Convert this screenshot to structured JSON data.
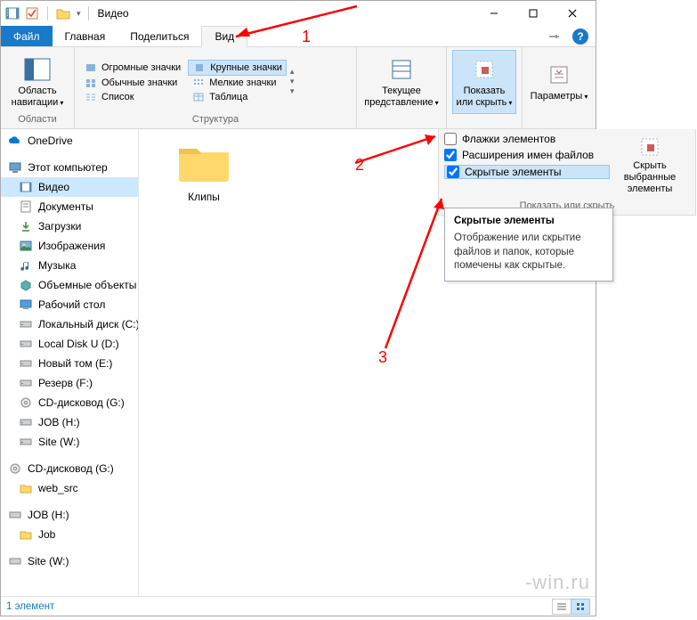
{
  "title": "Видео",
  "tabs": {
    "file": "Файл",
    "home": "Главная",
    "share": "Поделиться",
    "view": "Вид"
  },
  "ribbon": {
    "nav_pane": "Область навигации",
    "group_areas": "Области",
    "layouts": {
      "huge": "Огромные значки",
      "large": "Крупные значки",
      "medium": "Обычные значки",
      "small": "Мелкие значки",
      "list": "Список",
      "table": "Таблица"
    },
    "group_layout": "Структура",
    "current_view": "Текущее представление",
    "show_hide": "Показать или скрыть",
    "options": "Параметры"
  },
  "popout": {
    "checkboxes": "Флажки элементов",
    "extensions": "Расширения имен файлов",
    "hidden": "Скрытые элементы",
    "hide_selected_l1": "Скрыть выбранные",
    "hide_selected_l2": "элементы",
    "group": "Показать или скрыть"
  },
  "tooltip": {
    "title": "Скрытые элементы",
    "body": "Отображение или скрытие файлов и папок, которые помечены как скрытые."
  },
  "nav": {
    "onedrive": "OneDrive",
    "this_pc": "Этот компьютер",
    "videos": "Видео",
    "documents": "Документы",
    "downloads": "Загрузки",
    "pictures": "Изображения",
    "music": "Музыка",
    "objects3d": "Объемные объекты",
    "desktop": "Рабочий стол",
    "local_c": "Локальный диск (C:)",
    "local_d": "Local Disk U (D:)",
    "new_e": "Новый том (E:)",
    "reserve_f": "Резерв (F:)",
    "cd_g": "CD-дисковод (G:)",
    "job_h": "JOB (H:)",
    "site_w": "Site (W:)",
    "cd_g2": "CD-дисковод (G:)",
    "web_src": "web_src",
    "job_h2": "JOB (H:)",
    "job": "Job",
    "site_w2": "Site (W:)"
  },
  "content": {
    "folder1": "Клипы"
  },
  "status": {
    "count": "1 элемент"
  },
  "anno": {
    "n1": "1",
    "n2": "2",
    "n3": "3"
  },
  "watermark": "-win.ru"
}
